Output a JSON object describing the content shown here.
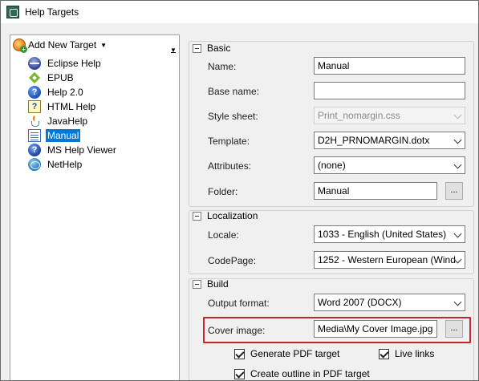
{
  "window": {
    "title": "Help Targets"
  },
  "tree": {
    "add_button_label": "Add New Target",
    "items": [
      {
        "label": "Eclipse Help",
        "icon": "eclipse-icon"
      },
      {
        "label": "EPUB",
        "icon": "epub-icon"
      },
      {
        "label": "Help 2.0",
        "icon": "help20-icon"
      },
      {
        "label": "HTML Help",
        "icon": "html-help-icon"
      },
      {
        "label": "JavaHelp",
        "icon": "java-icon"
      },
      {
        "label": "Manual",
        "icon": "manual-icon",
        "selected": true
      },
      {
        "label": "MS Help Viewer",
        "icon": "ms-help-viewer-icon"
      },
      {
        "label": "NetHelp",
        "icon": "nethelp-icon"
      }
    ]
  },
  "basic": {
    "title": "Basic",
    "name_label": "Name:",
    "name_value": "Manual",
    "base_name_label": "Base name:",
    "base_name_value": "",
    "style_sheet_label": "Style sheet:",
    "style_sheet_value": "Print_nomargin.css",
    "template_label": "Template:",
    "template_value": "D2H_PRNOMARGIN.dotx",
    "attributes_label": "Attributes:",
    "attributes_value": "(none)",
    "folder_label": "Folder:",
    "folder_value": "Manual",
    "browse_label": "..."
  },
  "localization": {
    "title": "Localization",
    "locale_label": "Locale:",
    "locale_value": "1033 - English (United States)",
    "codepage_label": "CodePage:",
    "codepage_value": "1252 - Western European (Wind"
  },
  "build": {
    "title": "Build",
    "output_format_label": "Output format:",
    "output_format_value": "Word 2007 (DOCX)",
    "cover_image_label": "Cover image:",
    "cover_image_value": "Media\\My Cover Image.jpg",
    "browse_label": "...",
    "generate_pdf_label": "Generate PDF target",
    "generate_pdf_checked": true,
    "live_links_label": "Live links",
    "live_links_checked": true,
    "create_outline_label": "Create outline in PDF target",
    "create_outline_checked": true
  },
  "colors": {
    "selection": "#0078d7",
    "highlight_border": "#c0282c"
  }
}
